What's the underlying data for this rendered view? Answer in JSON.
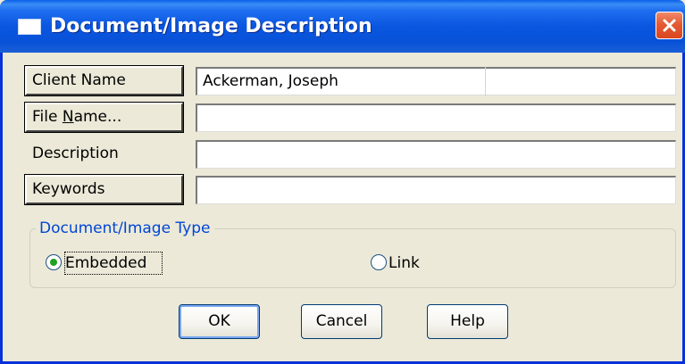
{
  "window": {
    "title": "Document/Image Description",
    "close_icon": "close-x-icon",
    "title_icon": "window-icon"
  },
  "fields": {
    "client_name": {
      "button_label": "Client Name",
      "value": "Ackerman, Joseph"
    },
    "file_name": {
      "button_label": "File Name...",
      "value": ""
    },
    "description": {
      "label": "Description",
      "value": ""
    },
    "keywords": {
      "button_label": "Keywords",
      "value": ""
    }
  },
  "doc_type": {
    "legend": "Document/Image Type",
    "options": [
      {
        "label": "Embedded",
        "selected": true
      },
      {
        "label": "Link",
        "selected": false
      }
    ]
  },
  "buttons": {
    "ok": "OK",
    "cancel": "Cancel",
    "help": "Help"
  },
  "colors": {
    "titlebar": "#0a56e0",
    "dialog_bg": "#ece9d8",
    "group_legend": "#0046d5",
    "radio_selected": "#21a121",
    "close_button": "#e55a34"
  }
}
